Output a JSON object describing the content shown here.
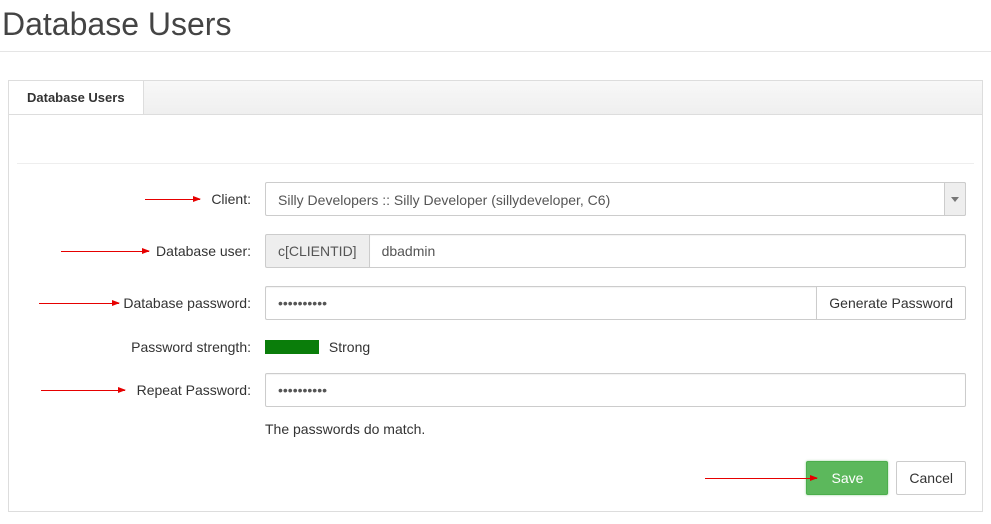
{
  "page": {
    "title": "Database Users"
  },
  "tabs": {
    "active_label": "Database Users"
  },
  "form": {
    "client": {
      "label": "Client:",
      "selected": "Silly Developers :: Silly Developer (sillydeveloper, C6)"
    },
    "db_user": {
      "label": "Database user:",
      "prefix": "c[CLIENTID]",
      "value": "dbadmin"
    },
    "db_password": {
      "label": "Database password:",
      "value": "••••••••••",
      "generate_button": "Generate Password"
    },
    "strength": {
      "label": "Password strength:",
      "text": "Strong"
    },
    "repeat": {
      "label": "Repeat Password:",
      "value": "••••••••••",
      "match_message": "The passwords do match."
    }
  },
  "actions": {
    "save": "Save",
    "cancel": "Cancel"
  }
}
